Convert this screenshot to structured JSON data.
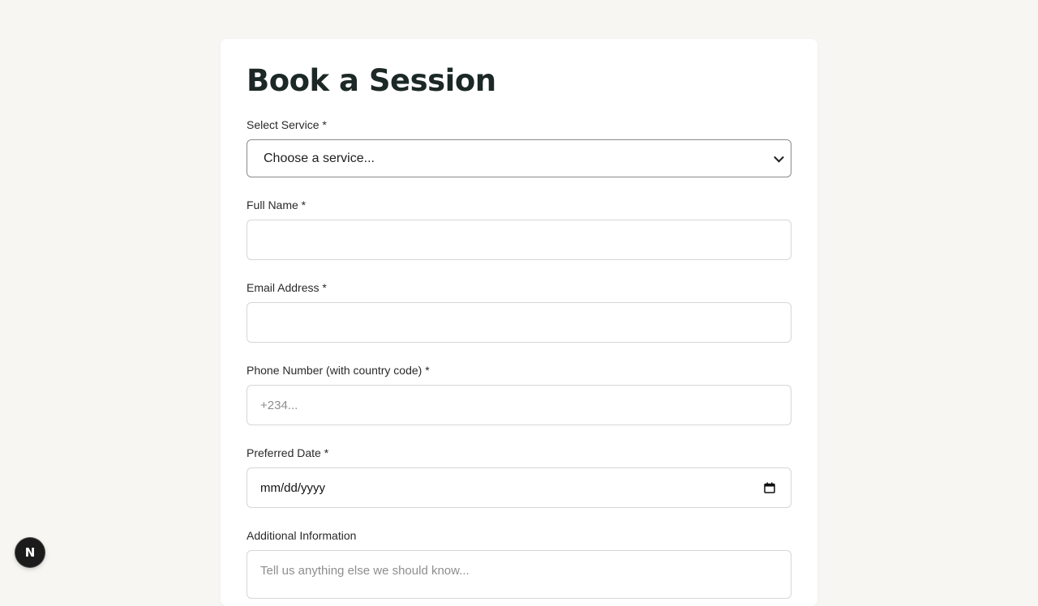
{
  "page": {
    "title": "Book a Session"
  },
  "form": {
    "service": {
      "label": "Select Service *",
      "selected": "Choose a service..."
    },
    "full_name": {
      "label": "Full Name *",
      "value": "",
      "placeholder": ""
    },
    "email": {
      "label": "Email Address *",
      "value": "",
      "placeholder": ""
    },
    "phone": {
      "label": "Phone Number (with country code) *",
      "value": "",
      "placeholder": "+234..."
    },
    "date": {
      "label": "Preferred Date *",
      "display": "mm/dd/yyyy"
    },
    "additional": {
      "label": "Additional Information",
      "placeholder": "Tell us anything else we should know..."
    }
  },
  "badge": {
    "letter": "N"
  },
  "icons": {
    "select": "chevron-down-icon",
    "date": "calendar-icon"
  },
  "colors": {
    "background": "#f8f6f3",
    "card": "#ffffff",
    "title": "#1b2826",
    "badge": "#1b1b1b"
  }
}
